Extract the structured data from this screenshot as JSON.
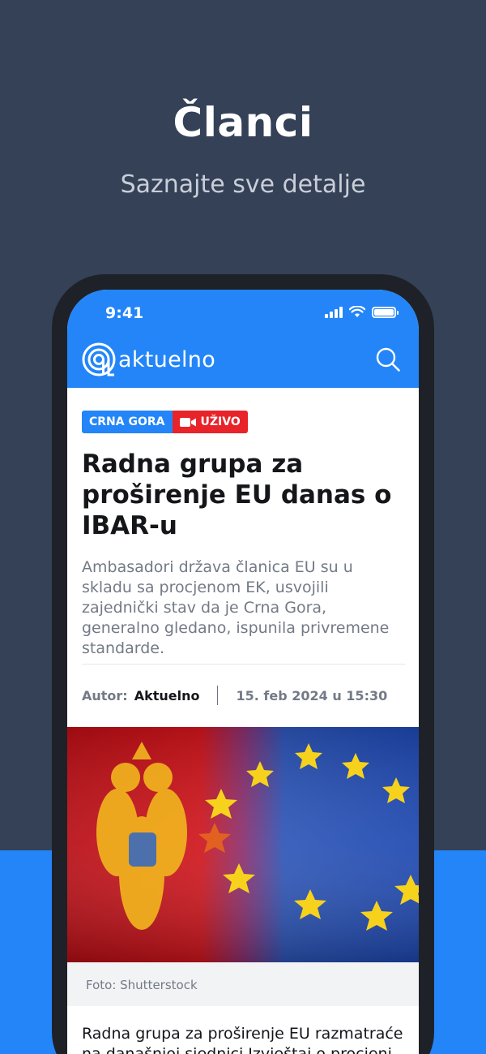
{
  "promo": {
    "title": "Članci",
    "subtitle": "Saznajte sve detalje"
  },
  "status_bar": {
    "time": "9:41",
    "icons": [
      "signal-icon",
      "wifi-icon",
      "battery-icon"
    ]
  },
  "header": {
    "logo_text": "aktuelno",
    "search_icon": "search-icon"
  },
  "article": {
    "category_tag": "CRNA GORA",
    "live_tag": "UŽIVO",
    "headline": "Radna grupa za proširenje EU danas o IBAR-u",
    "lead": "Ambasadori država članica EU su u skladu sa procjenom EK, usvojili zajednički stav da je Crna Gora, generalno gledano, ispunila privremene standarde.",
    "author_label": "Autor:",
    "author": "Aktuelno",
    "date": "15. feb 2024 u 15:30",
    "image_caption": "Foto: Shutterstock",
    "body_start": "Radna grupa za proširenje EU razmatraće na današnjoj sjednici Izvještaj o procjeni"
  },
  "colors": {
    "background": "#344157",
    "accent": "#2385f8",
    "live": "#e8232a"
  }
}
